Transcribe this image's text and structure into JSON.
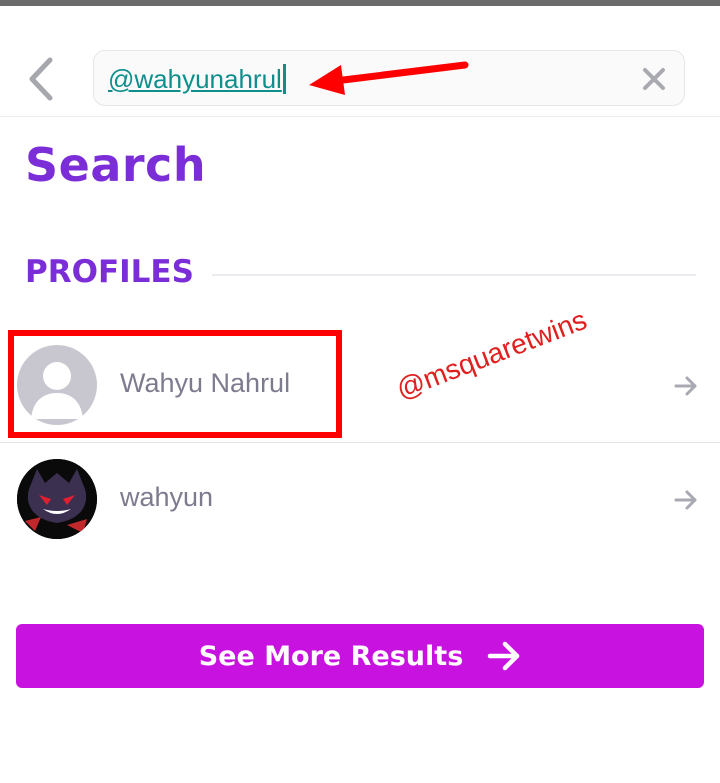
{
  "search": {
    "query": "@wahyunahrul",
    "clear_icon": "close-icon",
    "back_icon": "chevron-left-icon"
  },
  "page": {
    "title": "Search"
  },
  "profiles": {
    "label": "PROFILES",
    "items": [
      {
        "name": "Wahyu Nahrul",
        "avatar": "default-avatar-icon"
      },
      {
        "name": "wahyun",
        "avatar": "character-avatar"
      }
    ]
  },
  "watermark": {
    "text": "@msquaretwins"
  },
  "actions": {
    "see_more_label": "See More Results"
  },
  "colors": {
    "accent_purple": "#7b2ed8",
    "button_magenta": "#c812e0",
    "query_teal": "#0f8f8c",
    "annotation_red": "#ff0000"
  }
}
